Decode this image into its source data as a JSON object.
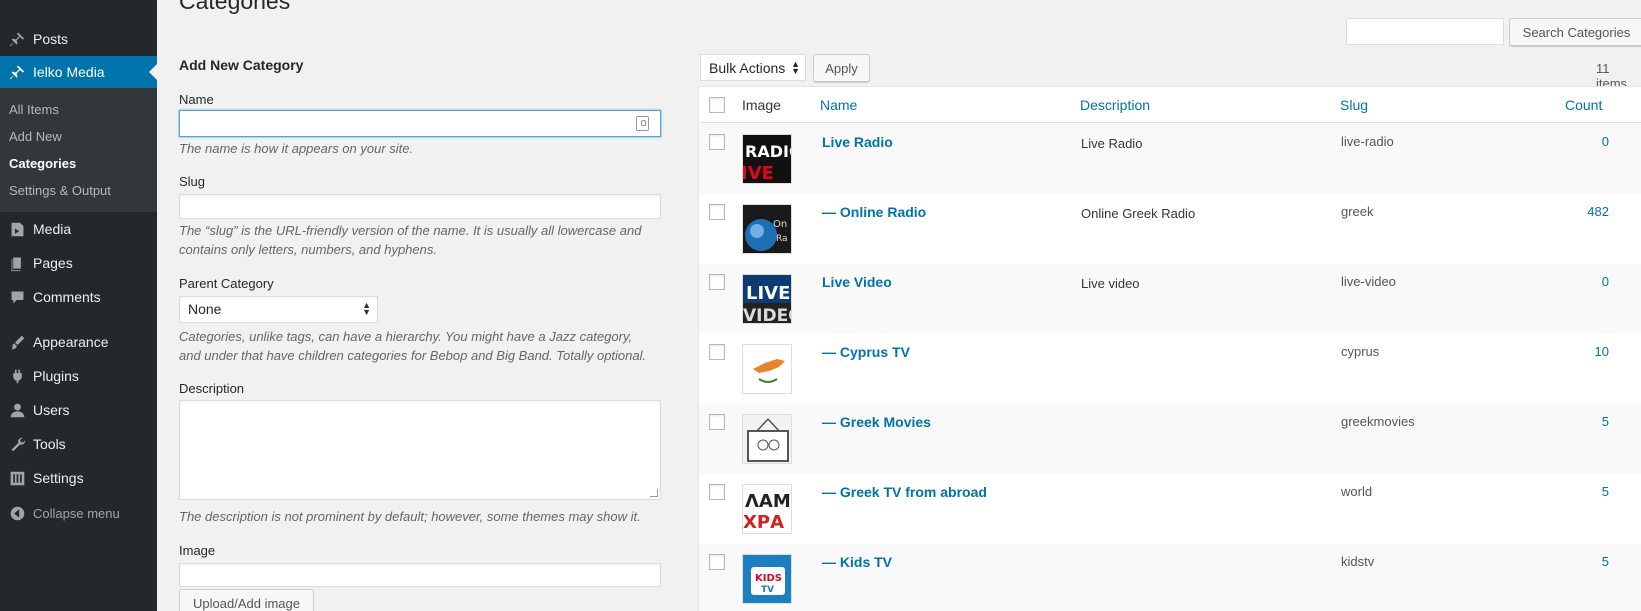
{
  "page_title": "Categories",
  "sidebar": {
    "items": [
      {
        "label": "Posts",
        "icon": "pin-icon"
      },
      {
        "label": "Ielko Media",
        "icon": "pin-icon",
        "current": true
      },
      {
        "label": "Media",
        "icon": "media-icon"
      },
      {
        "label": "Pages",
        "icon": "pages-icon"
      },
      {
        "label": "Comments",
        "icon": "comment-icon"
      },
      {
        "label": "Appearance",
        "icon": "brush-icon"
      },
      {
        "label": "Plugins",
        "icon": "plug-icon"
      },
      {
        "label": "Users",
        "icon": "user-icon"
      },
      {
        "label": "Tools",
        "icon": "wrench-icon"
      },
      {
        "label": "Settings",
        "icon": "sliders-icon"
      }
    ],
    "submenu": [
      "All Items",
      "Add New",
      "Categories",
      "Settings & Output"
    ],
    "collapse": "Collapse menu"
  },
  "form": {
    "title": "Add New Category",
    "name_label": "Name",
    "name_help": "The name is how it appears on your site.",
    "slug_label": "Slug",
    "slug_help_1": "The “slug” is the URL-friendly version of the name. It is usually all lowercase and",
    "slug_help_2": "contains only letters, numbers, and hyphens.",
    "parent_label": "Parent Category",
    "parent_value": "None",
    "parent_help_1": "Categories, unlike tags, can have a hierarchy. You might have a Jazz category,",
    "parent_help_2": "and under that have children categories for Bebop and Big Band. Totally optional.",
    "desc_label": "Description",
    "desc_help": "The description is not prominent by default; however, some themes may show it.",
    "image_label": "Image",
    "upload_button": "Upload/Add image"
  },
  "list": {
    "search_button": "Search Categories",
    "bulk_actions": "Bulk Actions",
    "apply": "Apply",
    "items_count": "11 items",
    "columns": {
      "image": "Image",
      "name": "Name",
      "description": "Description",
      "slug": "Slug",
      "count": "Count"
    },
    "rows": [
      {
        "name": "Live Radio",
        "description": "Live Radio",
        "slug": "live-radio",
        "count": "0"
      },
      {
        "name": "— Online Radio",
        "description": "Online Greek Radio",
        "slug": "greek",
        "count": "482"
      },
      {
        "name": "Live Video",
        "description": "Live video",
        "slug": "live-video",
        "count": "0"
      },
      {
        "name": "— Cyprus TV",
        "description": "",
        "slug": "cyprus",
        "count": "10"
      },
      {
        "name": "— Greek Movies",
        "description": "",
        "slug": "greekmovies",
        "count": "5"
      },
      {
        "name": "— Greek TV from abroad",
        "description": "",
        "slug": "world",
        "count": "5"
      },
      {
        "name": "— Kids TV",
        "description": "",
        "slug": "kidstv",
        "count": "5"
      }
    ]
  },
  "colors": {
    "sidebar": "#23282d",
    "accent": "#0073aa",
    "link": "#0073aa"
  }
}
